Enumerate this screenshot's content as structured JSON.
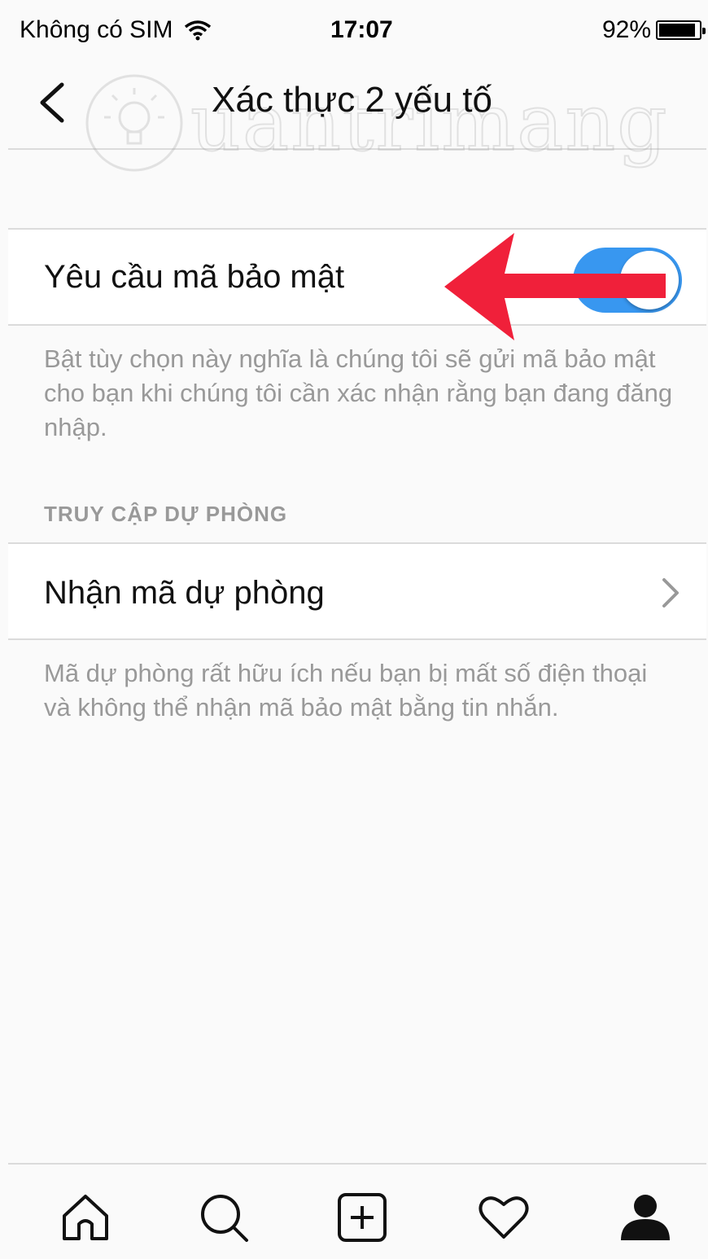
{
  "status_bar": {
    "carrier": "Không có SIM",
    "time": "17:07",
    "battery_percent": "92%",
    "battery_level": 0.92
  },
  "nav": {
    "title": "Xác thực 2 yếu tố",
    "watermark": "uantrimang"
  },
  "security_code": {
    "label": "Yêu cầu mã bảo mật",
    "toggle_on": true,
    "description": "Bật tùy chọn này nghĩa là chúng tôi sẽ gửi mã bảo mật cho bạn khi chúng tôi cần xác nhận rằng bạn đang đăng nhập."
  },
  "backup_section": {
    "header": "TRUY CẬP DỰ PHÒNG",
    "item_label": "Nhận mã dự phòng",
    "description": "Mã dự phòng rất hữu ích nếu bạn bị mất số điện thoại và không thể nhận mã bảo mật bằng tin nhắn."
  },
  "tab_bar": {
    "tabs": [
      "home-icon",
      "search-icon",
      "add-post-icon",
      "heart-icon",
      "profile-icon"
    ]
  },
  "colors": {
    "toggle_accent": "#3897f0",
    "annotation_arrow": "#f0203a"
  }
}
